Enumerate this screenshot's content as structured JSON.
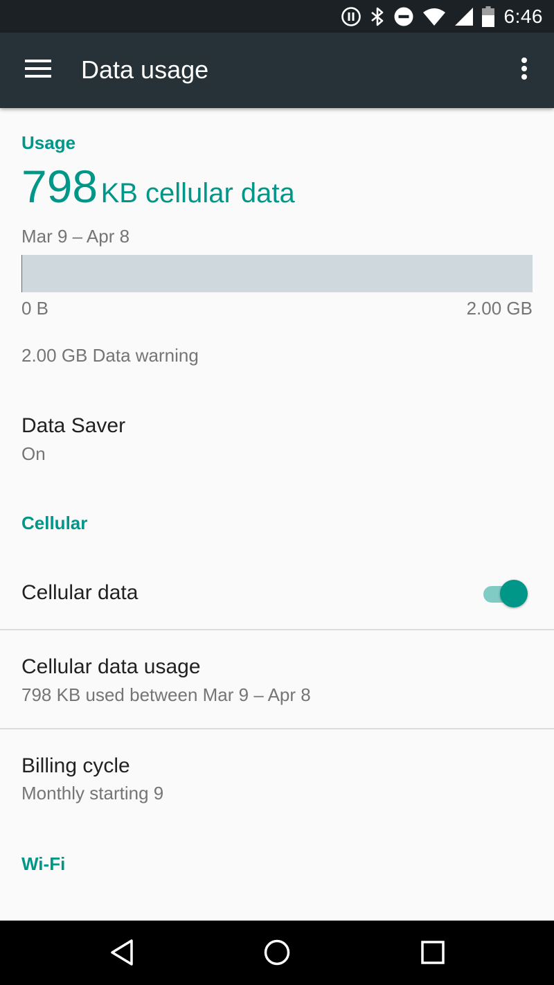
{
  "status_bar": {
    "time": "6:46",
    "icons": [
      "pause-circle-icon",
      "bluetooth-icon",
      "do-not-disturb-icon",
      "wifi-icon",
      "cellular-signal-icon",
      "battery-icon"
    ]
  },
  "app_bar": {
    "title": "Data usage",
    "menu_icon": "hamburger-menu-icon",
    "overflow_icon": "more-vert-icon"
  },
  "usage": {
    "section_label": "Usage",
    "amount": "798",
    "amount_unit": "KB cellular data",
    "period": "Mar 9 – Apr 8",
    "bar_min_label": "0 B",
    "bar_max_label": "2.00 GB",
    "bar_fill_fraction": 0.0004,
    "warning": "2.00 GB Data warning"
  },
  "data_saver": {
    "title": "Data Saver",
    "summary": "On"
  },
  "cellular": {
    "section_label": "Cellular",
    "cellular_data_label": "Cellular data",
    "cellular_data_enabled": true,
    "usage_title": "Cellular data usage",
    "usage_summary": "798 KB used between Mar 9 – Apr 8",
    "billing_title": "Billing cycle",
    "billing_summary": "Monthly starting 9"
  },
  "wifi": {
    "section_label": "Wi-Fi"
  },
  "nav_bar": {
    "buttons": [
      "back-icon",
      "home-icon",
      "recents-icon"
    ]
  },
  "colors": {
    "accent": "#009688",
    "app_bar": "#263238",
    "status_bar": "#1c2125",
    "bar_track": "#cfd8dc",
    "toggle_track": "#80cbc4"
  }
}
